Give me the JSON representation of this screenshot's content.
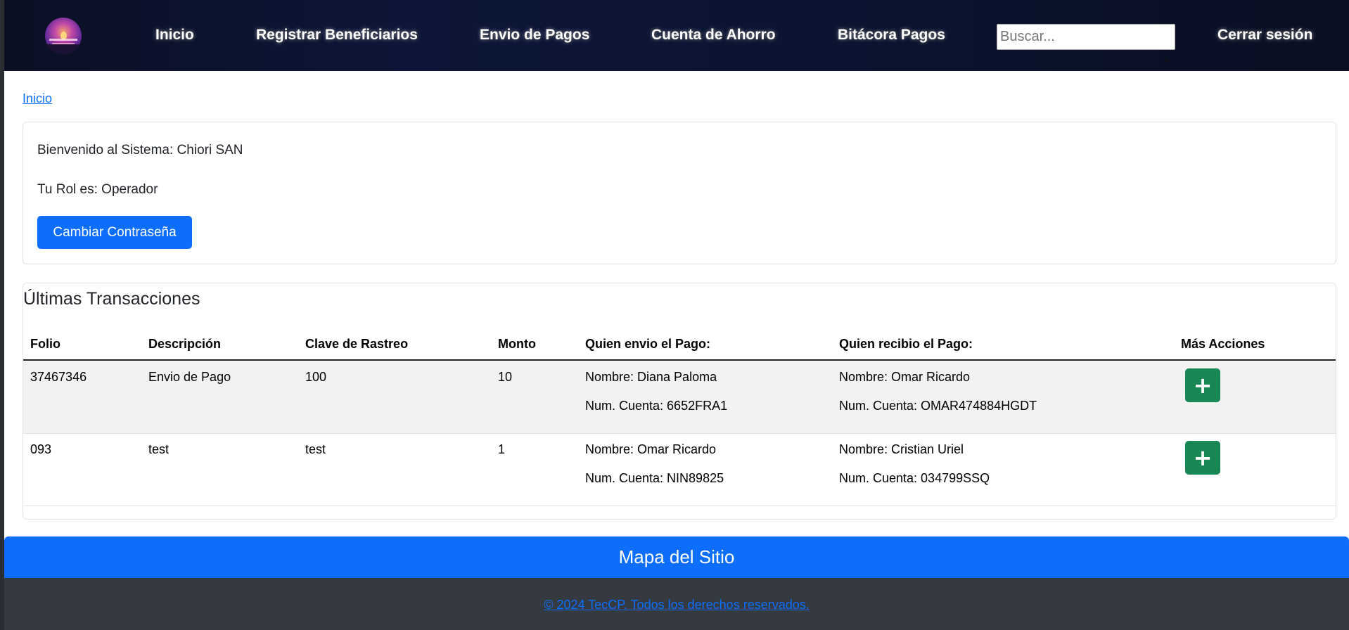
{
  "nav": {
    "links": [
      "Inicio",
      "Registrar Beneficiarios",
      "Envio de Pagos",
      "Cuenta de Ahorro",
      "Bitácora Pagos"
    ],
    "search_placeholder": "Buscar...",
    "logout_label": "Cerrar sesión"
  },
  "breadcrumb": {
    "home": "Inicio"
  },
  "welcome": {
    "greeting": "Bienvenido al Sistema: Chiori SAN",
    "role": "Tu Rol es: Operador",
    "change_password_label": "Cambiar Contraseña"
  },
  "transactions": {
    "title": "Últimas Transacciones",
    "columns": [
      "Folio",
      "Descripción",
      "Clave de Rastreo",
      "Monto",
      "Quien envio el Pago:",
      "Quien recibio el Pago:",
      "Más Acciones"
    ],
    "rows": [
      {
        "folio": "37467346",
        "descripcion": "Envio de Pago",
        "clave": "100",
        "monto": "10",
        "sender_name": "Nombre: Diana Paloma",
        "sender_account": "Num. Cuenta: 6652FRA1",
        "receiver_name": "Nombre: Omar Ricardo",
        "receiver_account": "Num. Cuenta: OMAR474884HGDT",
        "action_icon": "+"
      },
      {
        "folio": "093",
        "descripcion": "test",
        "clave": "test",
        "monto": "1",
        "sender_name": "Nombre: Omar Ricardo",
        "sender_account": "Num. Cuenta: NIN89825",
        "receiver_name": "Nombre: Cristian Uriel",
        "receiver_account": "Num. Cuenta: 034799SSQ",
        "action_icon": "+"
      }
    ]
  },
  "footer": {
    "sitemap_label": "Mapa del Sitio",
    "copyright": "© 2024 TecCP. Todos los derechos reservados."
  },
  "colors": {
    "primary": "#0d6efd",
    "success": "#198754",
    "navbar": "#0d1638",
    "footer": "#343a40"
  }
}
